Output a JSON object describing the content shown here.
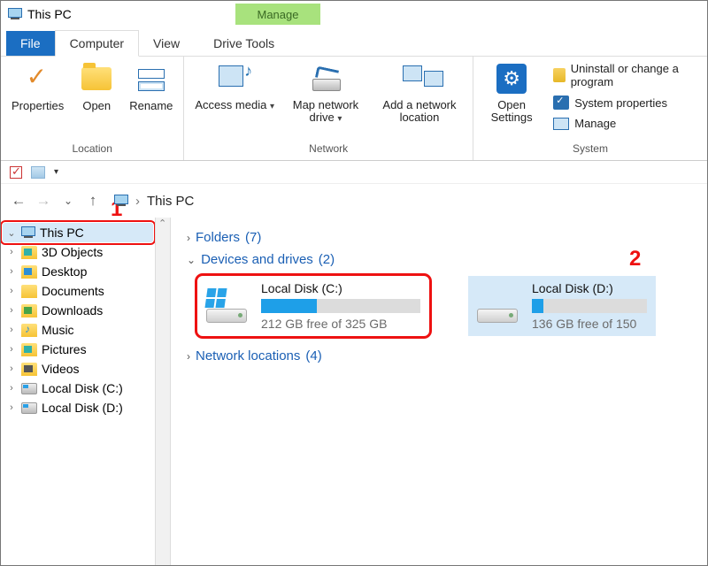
{
  "titlebar": {
    "title": "This PC"
  },
  "tabs": {
    "manage_badge": "Manage",
    "file": "File",
    "computer": "Computer",
    "view": "View",
    "drive_tools": "Drive Tools"
  },
  "ribbon": {
    "location": {
      "label": "Location",
      "properties": "Properties",
      "open": "Open",
      "rename": "Rename"
    },
    "network": {
      "label": "Network",
      "access_media": "Access media",
      "map_drive": "Map network drive",
      "add_network": "Add a network location"
    },
    "open_settings": "Open Settings",
    "system": {
      "label": "System",
      "uninstall": "Uninstall or change a program",
      "sysprops": "System properties",
      "manage": "Manage"
    }
  },
  "breadcrumb": {
    "root": "This PC"
  },
  "annotations": {
    "one": "1",
    "two": "2"
  },
  "tree": {
    "this_pc": "This PC",
    "items": [
      "3D Objects",
      "Desktop",
      "Documents",
      "Downloads",
      "Music",
      "Pictures",
      "Videos",
      "Local Disk (C:)",
      "Local Disk (D:)"
    ]
  },
  "content": {
    "folders": {
      "label": "Folders",
      "count": "(7)"
    },
    "devices": {
      "label": "Devices and drives",
      "count": "(2)"
    },
    "netloc": {
      "label": "Network locations",
      "count": "(4)"
    },
    "drive_c": {
      "name": "Local Disk (C:)",
      "free_text": "212 GB free of 325 GB",
      "fill_pct": 35
    },
    "drive_d": {
      "name": "Local Disk (D:)",
      "free_text": "136 GB free of 150",
      "fill_pct": 10
    }
  }
}
